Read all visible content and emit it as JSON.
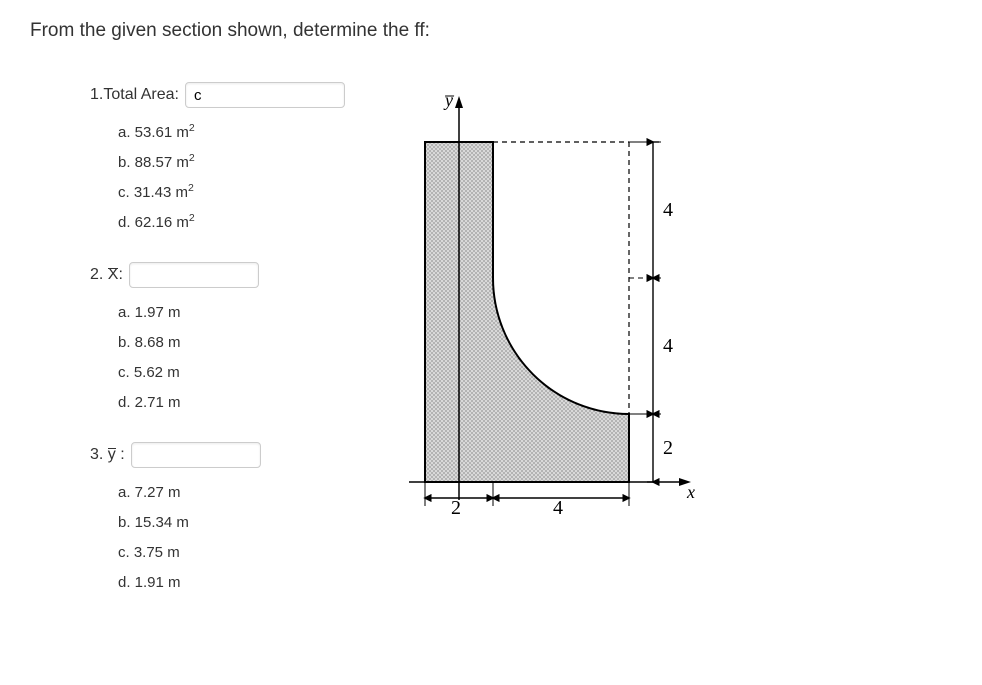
{
  "prompt": "From the given section shown, determine the ff:",
  "questions": {
    "q1": {
      "label": "1.Total Area:",
      "value": "c",
      "options": {
        "a": "a. 53.61 m",
        "b": "b. 88.57 m",
        "c": "c. 31.43 m",
        "d": "d. 62.16 m"
      },
      "unit_sup": "2"
    },
    "q2": {
      "label_prefix": "2. ",
      "label_var": "X",
      "label_suffix": ":",
      "value": "",
      "options": {
        "a": "a. 1.97 m",
        "b": "b.  8.68 m",
        "c": "c. 5.62 m",
        "d": "d. 2.71 m"
      }
    },
    "q3": {
      "label_prefix": "3. ",
      "label_var": "y",
      "label_suffix": " :",
      "value": "",
      "options": {
        "a": "a. 7.27 m",
        "b": "b. 15.34 m",
        "c": "c. 3.75 m",
        "d": "d. 1.91 m"
      }
    }
  },
  "figure": {
    "y_axis_label": "y̅",
    "x_axis_label": "x",
    "dims": {
      "left_width": "2",
      "right_width": "4",
      "top_height": "4",
      "mid_height": "4",
      "bottom_height": "2"
    }
  }
}
